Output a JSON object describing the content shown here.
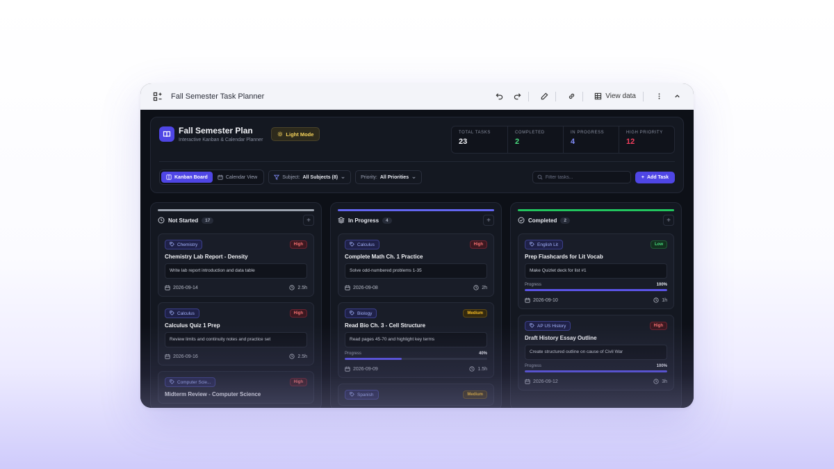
{
  "window": {
    "title": "Fall Semester Task Planner",
    "view_data_label": "View data"
  },
  "header": {
    "title": "Fall Semester Plan",
    "subtitle": "Interactive Kanban & Calendar Planner",
    "mode_label": "Light Mode",
    "stats": [
      {
        "label": "TOTAL TASKS",
        "value": "23",
        "color": "#f3f4f8"
      },
      {
        "label": "COMPLETED",
        "value": "2",
        "color": "#4ade80"
      },
      {
        "label": "IN PROGRESS",
        "value": "4",
        "color": "#818cf8"
      },
      {
        "label": "HIGH PRIORITY",
        "value": "12",
        "color": "#f43f5e"
      }
    ]
  },
  "toolbar": {
    "kanban_label": "Kanban Board",
    "calendar_label": "Calendar View",
    "subject_label": "Subject:",
    "subject_value": "All Subjects (8)",
    "priority_label": "Priority:",
    "priority_value": "All Priorities",
    "search_placeholder": "Filter tasks...",
    "add_label": "Add Task"
  },
  "columns": [
    {
      "title": "Not Started",
      "count": "17",
      "bar_color": "#9ca3af",
      "cards": [
        {
          "tag": "Chemistry",
          "priority": "High",
          "title": "Chemistry Lab Report - Density",
          "desc": "Write lab report introduction and data table",
          "date": "2026-09-14",
          "hours": "2.5h"
        },
        {
          "tag": "Calculus",
          "priority": "High",
          "title": "Calculus Quiz 1 Prep",
          "desc": "Review limits and continuity notes and practice set",
          "date": "2026-09-16",
          "hours": "2.5h"
        },
        {
          "tag": "Computer Scie...",
          "priority": "High",
          "title": "Midterm Review - Computer Science",
          "desc": "",
          "date": "",
          "hours": ""
        }
      ]
    },
    {
      "title": "In Progress",
      "count": "4",
      "bar_color": "#6366f1",
      "cards": [
        {
          "tag": "Calculus",
          "priority": "High",
          "title": "Complete Math Ch. 1 Practice",
          "desc": "Solve odd-numbered problems 1-35",
          "date": "2026-09-08",
          "hours": "2h"
        },
        {
          "tag": "Biology",
          "priority": "Medium",
          "title": "Read Bio Ch. 3 - Cell Structure",
          "desc": "Read pages 45-70 and highlight key terms",
          "progress_label": "Progress",
          "progress": 40,
          "progress_text": "40%",
          "date": "2026-09-09",
          "hours": "1.5h"
        },
        {
          "tag": "Spanish",
          "priority": "Medium",
          "title": "",
          "desc": "",
          "date": "",
          "hours": ""
        }
      ]
    },
    {
      "title": "Completed",
      "count": "2",
      "bar_color": "#22c55e",
      "cards": [
        {
          "tag": "English Lit",
          "priority": "Low",
          "title": "Prep Flashcards for Lit Vocab",
          "desc": "Make Quizlet deck for list #1",
          "progress_label": "Progress",
          "progress": 100,
          "progress_text": "100%",
          "date": "2026-09-10",
          "hours": "1h"
        },
        {
          "tag": "AP US History",
          "priority": "High",
          "title": "Draft History Essay Outline",
          "desc": "Create structured outline on cause of Civil War",
          "progress_label": "Progress",
          "progress": 100,
          "progress_text": "100%",
          "date": "2026-09-12",
          "hours": "3h"
        }
      ]
    }
  ],
  "colors": {
    "accent": "#4f46e5",
    "high_text": "#f87171",
    "high_bg": "#3a1820",
    "high_border": "#6b2230",
    "medium_text": "#fbbf24",
    "medium_bg": "#33290f",
    "medium_border": "#5e4914",
    "low_text": "#4ade80",
    "low_bg": "#12301e",
    "low_border": "#1f5a35",
    "tag_text": "#a5b4fc",
    "tag_bg": "#1f2148",
    "tag_border": "#3b3f8a"
  }
}
